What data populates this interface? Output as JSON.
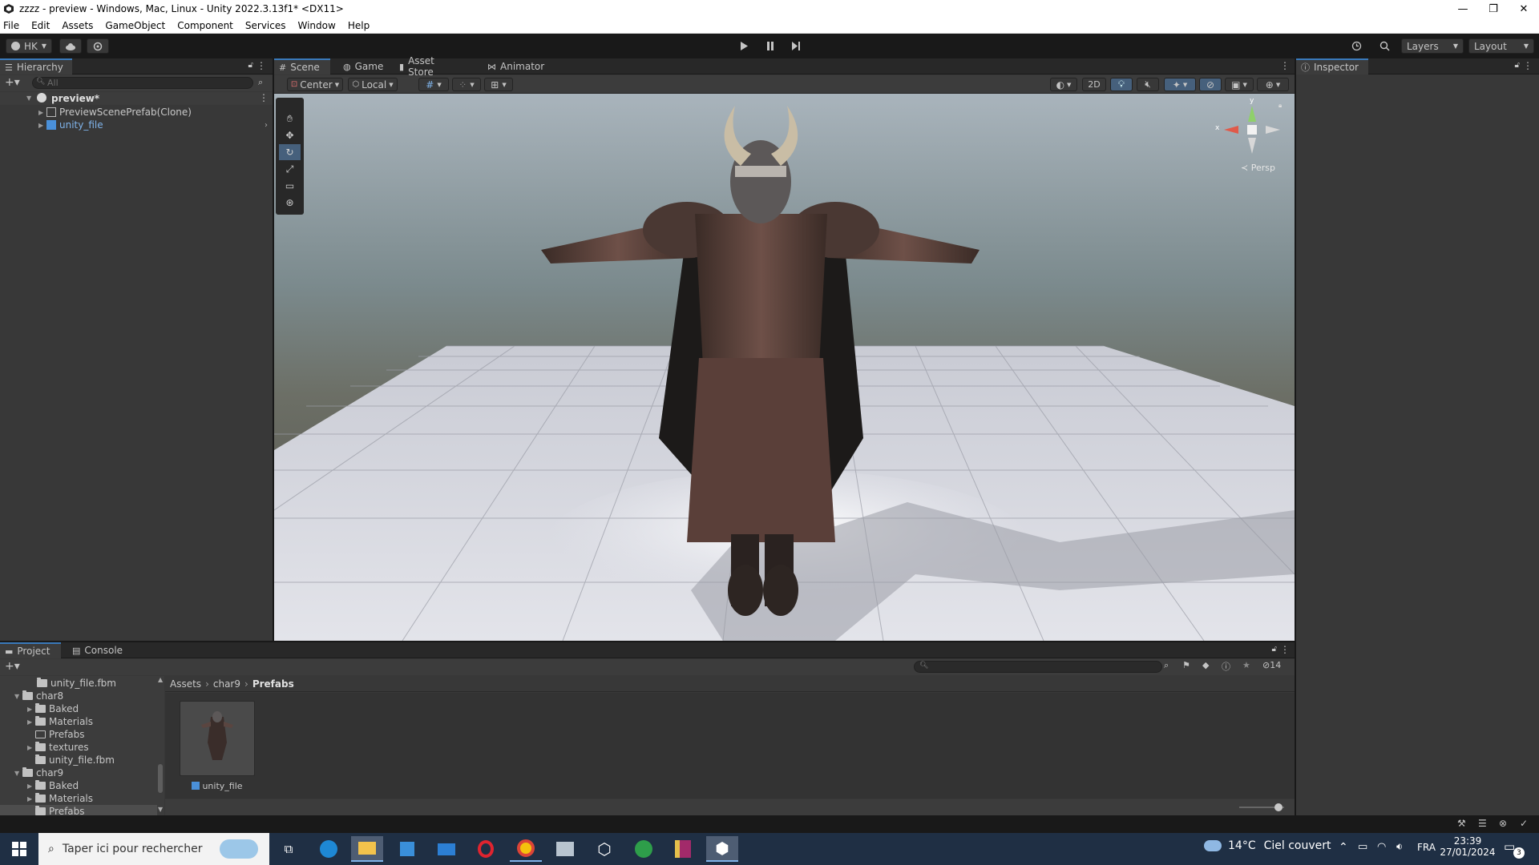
{
  "window": {
    "title": "zzzz - preview - Windows, Mac, Linux - Unity 2022.3.13f1* <DX11>",
    "minimize": "—",
    "maximize": "❐",
    "close": "✕"
  },
  "menu": [
    "File",
    "Edit",
    "Assets",
    "GameObject",
    "Component",
    "Services",
    "Window",
    "Help"
  ],
  "toolbar": {
    "account": "HK",
    "layers": "Layers",
    "layout": "Layout"
  },
  "hierarchy": {
    "tab": "Hierarchy",
    "search_placeholder": "All",
    "scene": "preview*",
    "items": [
      "PreviewScenePrefab(Clone)",
      "unity_file"
    ]
  },
  "scene_tabs": [
    "Scene",
    "Game",
    "Asset Store",
    "Animator"
  ],
  "scene_toolbar": {
    "pivot": "Center",
    "space": "Local",
    "mode_2d": "2D"
  },
  "scene": {
    "persp": "Persp",
    "axis_x": "x",
    "axis_y": "y"
  },
  "inspector": {
    "tab": "Inspector"
  },
  "project": {
    "tabs": [
      "Project",
      "Console"
    ],
    "tree": [
      {
        "label": "unity_file.fbm",
        "depth": 2,
        "type": "folder",
        "expand": false
      },
      {
        "label": "char8",
        "depth": 1,
        "type": "folder",
        "expand": true
      },
      {
        "label": "Baked",
        "depth": 2,
        "type": "folder",
        "expand": false
      },
      {
        "label": "Materials",
        "depth": 2,
        "type": "folder",
        "expand": false
      },
      {
        "label": "Prefabs",
        "depth": 2,
        "type": "empty",
        "expand": null
      },
      {
        "label": "textures",
        "depth": 2,
        "type": "folder",
        "expand": false
      },
      {
        "label": "unity_file.fbm",
        "depth": 2,
        "type": "folder",
        "expand": null
      },
      {
        "label": "char9",
        "depth": 1,
        "type": "folder",
        "expand": true
      },
      {
        "label": "Baked",
        "depth": 2,
        "type": "folder",
        "expand": false
      },
      {
        "label": "Materials",
        "depth": 2,
        "type": "folder",
        "expand": false
      },
      {
        "label": "Prefabs",
        "depth": 2,
        "type": "folder",
        "expand": null,
        "selected": true
      }
    ],
    "breadcrumb": [
      "Assets",
      "char9",
      "Prefabs"
    ],
    "asset_name": "unity_file",
    "hidden_count": "14"
  },
  "taskbar": {
    "search_placeholder": "Taper ici pour rechercher",
    "weather_temp": "14°C",
    "weather_text": "Ciel couvert",
    "language": "FRA",
    "time": "23:39",
    "date": "27/01/2024",
    "notif_count": "3"
  }
}
